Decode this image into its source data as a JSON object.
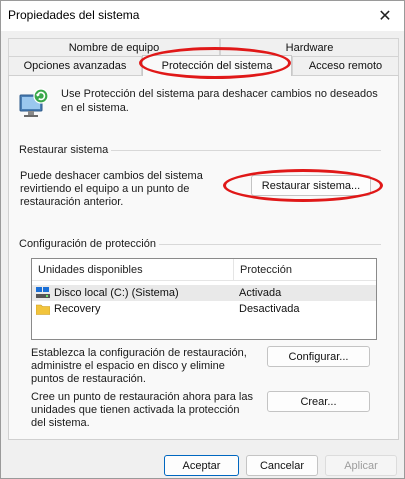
{
  "window": {
    "title": "Propiedades del sistema"
  },
  "tabs": {
    "row1": [
      "Nombre de equipo",
      "Hardware"
    ],
    "row2": [
      "Opciones avanzadas",
      "Protección del sistema",
      "Acceso remoto"
    ]
  },
  "intro": "Use Protección del sistema para deshacer cambios no deseados en el sistema.",
  "restore": {
    "title": "Restaurar sistema",
    "text": "Puede deshacer cambios del sistema revirtiendo el equipo a un punto de restauración anterior.",
    "button": "Restaurar sistema..."
  },
  "protection": {
    "title": "Configuración de protección",
    "columns": [
      "Unidades disponibles",
      "Protección"
    ],
    "rows": [
      {
        "drive": "Disco local (C:) (Sistema)",
        "status": "Activada",
        "icon": "system-drive-icon"
      },
      {
        "drive": "Recovery",
        "status": "Desactivada",
        "icon": "folder-icon"
      }
    ],
    "config_text": "Establezca la configuración de restauración, administre el espacio en disco y elimine puntos de restauración.",
    "config_button": "Configurar...",
    "create_text": "Cree un punto de restauración ahora para las unidades que tienen activada la protección del sistema.",
    "create_button": "Crear..."
  },
  "footer": {
    "ok": "Aceptar",
    "cancel": "Cancelar",
    "apply": "Aplicar"
  },
  "colors": {
    "annotation": "#e01818",
    "accent": "#0067c0"
  }
}
